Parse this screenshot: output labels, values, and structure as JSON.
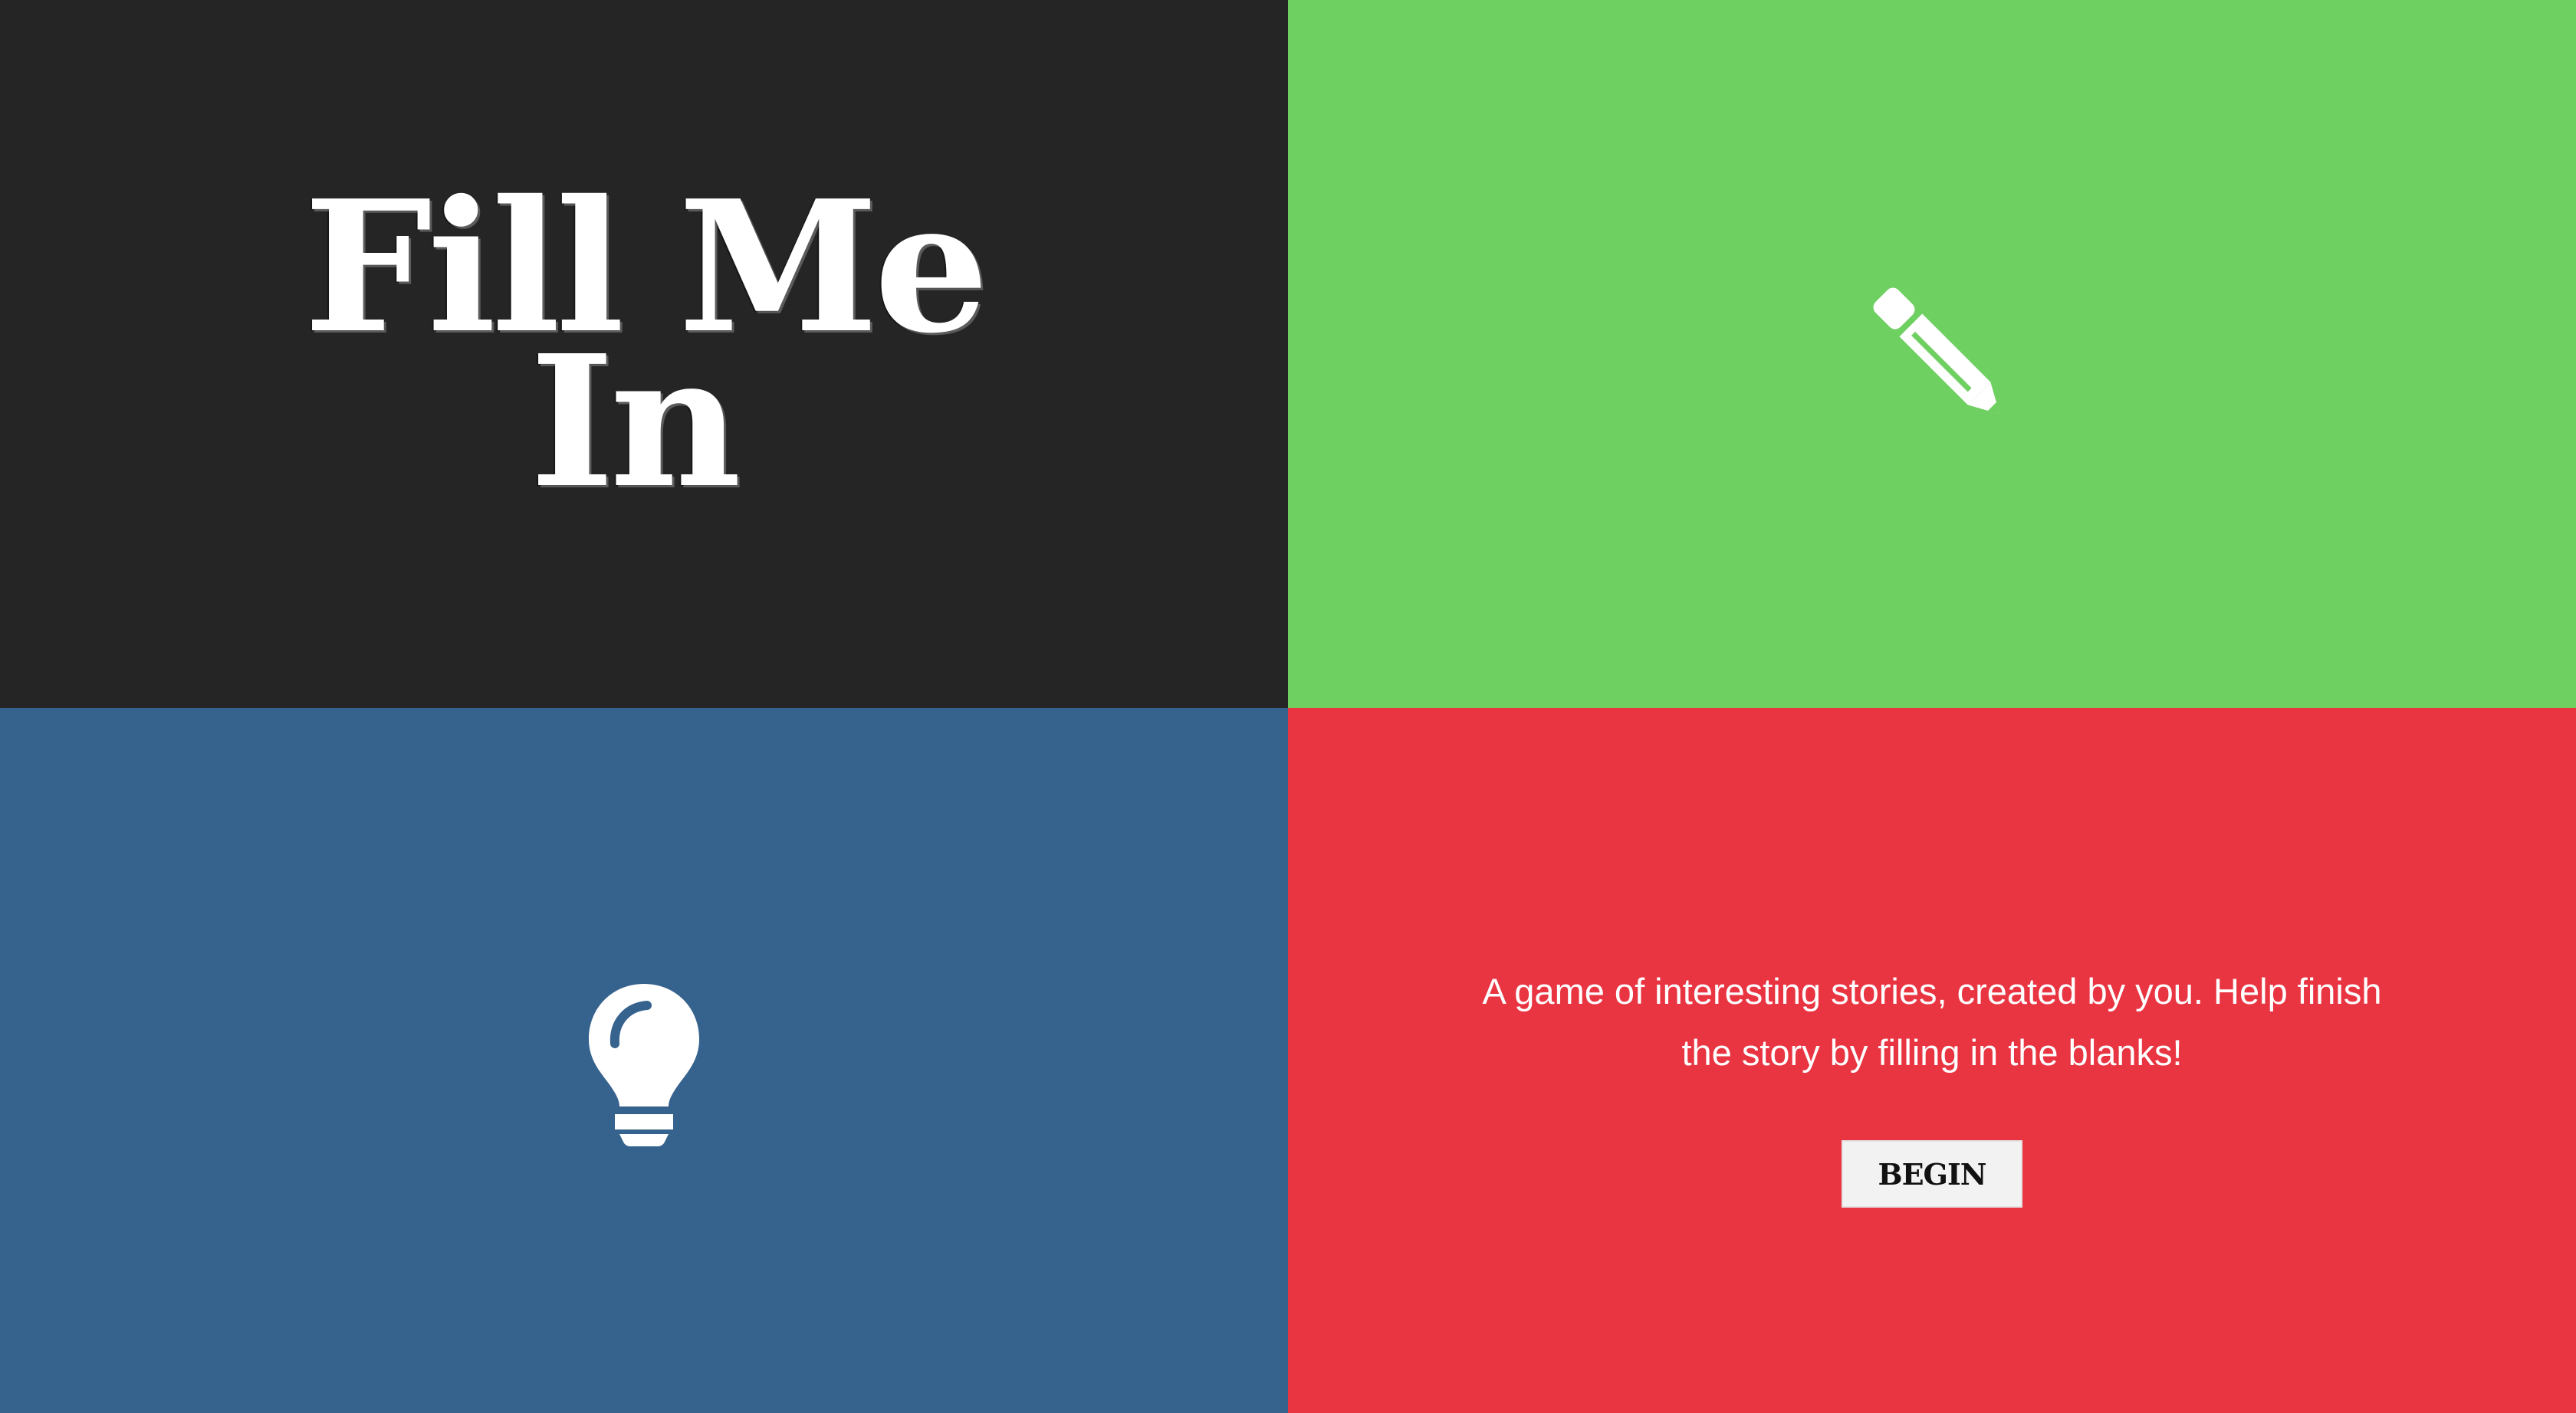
{
  "title": {
    "line1": "Fill Me",
    "line2": "In"
  },
  "panels": {
    "top_left": {
      "color": "#262526"
    },
    "top_right": {
      "color": "#6fd062",
      "icon": "pencil-icon"
    },
    "bottom_left": {
      "color": "#36628e",
      "icon": "lightbulb-icon"
    },
    "bottom_right": {
      "color": "#e93441"
    }
  },
  "intro": {
    "tagline": "A game of interesting stories, created by you. Help finish the story by filling in the blanks!",
    "begin_label": "BEGIN"
  }
}
